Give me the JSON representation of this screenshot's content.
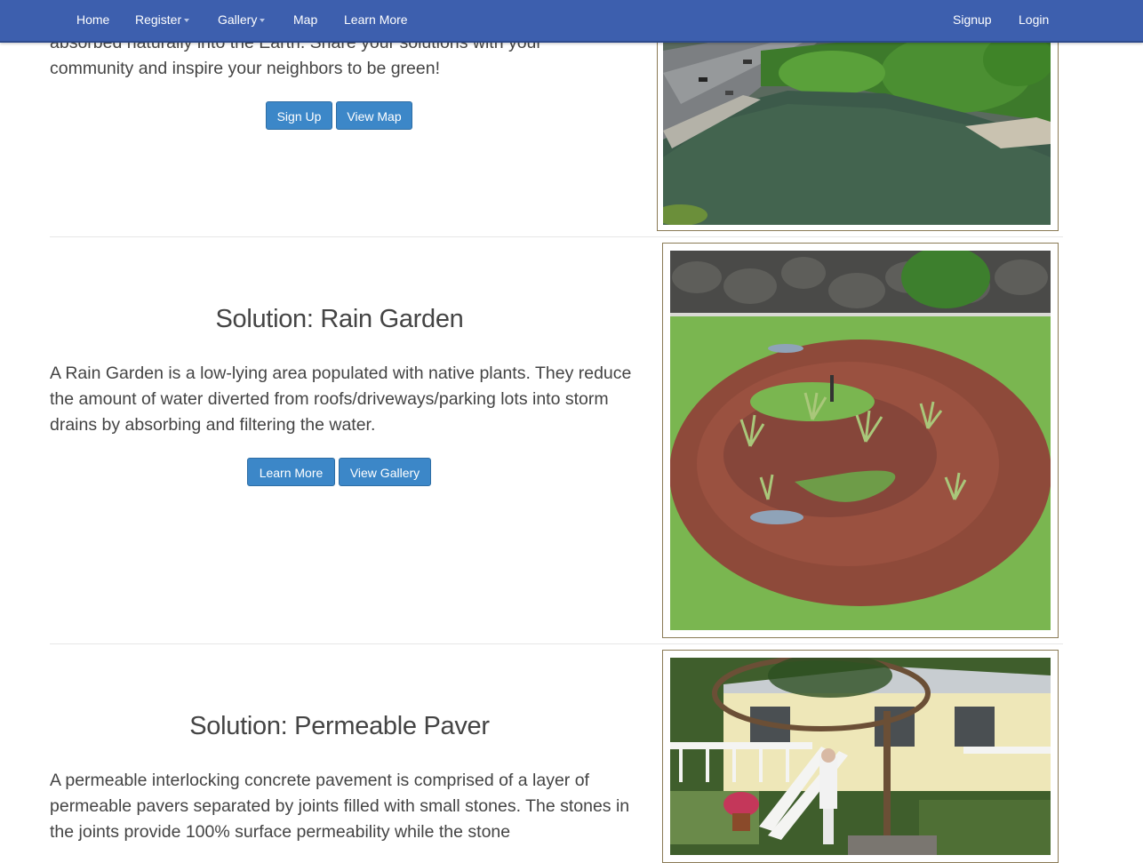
{
  "nav": {
    "home": "Home",
    "register": "Register",
    "gallery": "Gallery",
    "map": "Map",
    "learn_more": "Learn More",
    "signup": "Signup",
    "login": "Login"
  },
  "intro": {
    "line1": "absorbed naturally into the Earth. Share your solutions with your",
    "line2": "community and inspire your neighbors to be green!",
    "sign_up_button": "Sign Up",
    "view_map_button": "View Map"
  },
  "rain_garden": {
    "title": "Solution: Rain Garden",
    "text": "A Rain Garden is a low-lying area populated with native plants. They reduce the amount of water diverted from roofs/driveways/parking lots into storm drains by absorbing and filtering the water.",
    "learn_more_button": "Learn More",
    "view_gallery_button": "View Gallery"
  },
  "permeable_paver": {
    "title": "Solution: Permeable Paver",
    "text": "A permeable interlocking concrete pavement is comprised of a layer of permeable pavers separated by joints filled with small stones. The stones in the joints provide 100% surface permeability while the stone"
  }
}
